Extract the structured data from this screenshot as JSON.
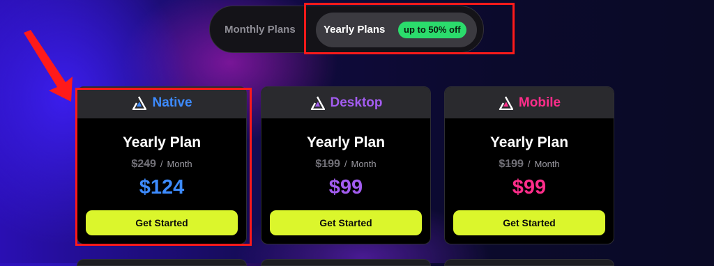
{
  "toggle": {
    "monthly_label": "Monthly Plans",
    "yearly_label": "Yearly Plans",
    "discount_badge": "up to 50% off",
    "selected": "Yearly Plans"
  },
  "cards": [
    {
      "title": "Native",
      "plan": "Yearly Plan",
      "old_price": "$249",
      "period": "Month",
      "separator": "/",
      "price": "$124",
      "cta": "Get Started",
      "accent": "#3d8bff",
      "icon": "app-logo-icon"
    },
    {
      "title": "Desktop",
      "plan": "Yearly Plan",
      "old_price": "$199",
      "period": "Month",
      "separator": "/",
      "price": "$99",
      "cta": "Get Started",
      "accent": "#a35cf0",
      "icon": "app-logo-icon"
    },
    {
      "title": "Mobile",
      "plan": "Yearly Plan",
      "old_price": "$199",
      "period": "Month",
      "separator": "/",
      "price": "$99",
      "cta": "Get Started",
      "accent": "#ff2d8a",
      "icon": "app-logo-icon"
    }
  ],
  "colors": {
    "highlight": "#ff1a1a",
    "cta_background": "#dbf62c",
    "badge_background": "#2bdc6c"
  }
}
